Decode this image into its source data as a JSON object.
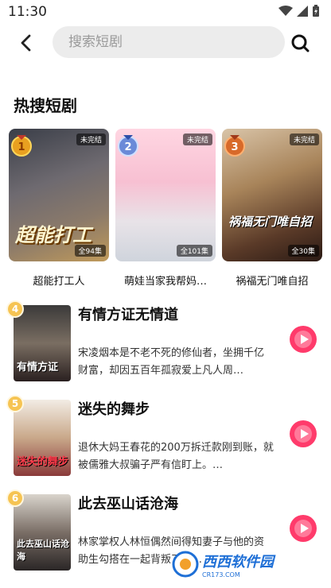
{
  "status_bar": {
    "time": "11:30"
  },
  "search": {
    "placeholder": "搜索短剧",
    "value": ""
  },
  "hot_section": {
    "title": "热搜短剧",
    "items": [
      {
        "rank": "1",
        "name": "超能打工人",
        "status": "未完结",
        "episodes": "全94集",
        "poster_text": "超能打工"
      },
      {
        "rank": "2",
        "name": "萌娃当家我帮妈…",
        "status": "未完结",
        "episodes": "全101集",
        "poster_text": ""
      },
      {
        "rank": "3",
        "name": "祸福无门唯自招",
        "status": "未完结",
        "episodes": "全30集",
        "poster_text": "祸福无门唯自招"
      }
    ]
  },
  "list": [
    {
      "rank": "4",
      "title": "有情方证无情道",
      "desc": "宋凌烟本是不老不死的修仙者，坐拥千亿财富，却因五百年孤寂爱上凡人周…",
      "poster_text": "有情方证"
    },
    {
      "rank": "5",
      "title": "迷失的舞步",
      "desc": "退休大妈王春花的200万拆迁款刚到账，就被儒雅大叔骗子严有信盯上。…",
      "poster_text": "迷失的舞步"
    },
    {
      "rank": "6",
      "title": "此去巫山话沧海",
      "desc": "林家掌权人林恒偶然间得知妻子与他的资助生勾搭在一起背叛了他…",
      "poster_text": "此去巫山话沧海"
    }
  ],
  "watermark": {
    "text": "西西软件园",
    "sub": "CR173.COM"
  },
  "colors": {
    "accent_play": "#ff3b6b",
    "medal_gold": "#f6c453",
    "search_bg": "#ececec"
  }
}
